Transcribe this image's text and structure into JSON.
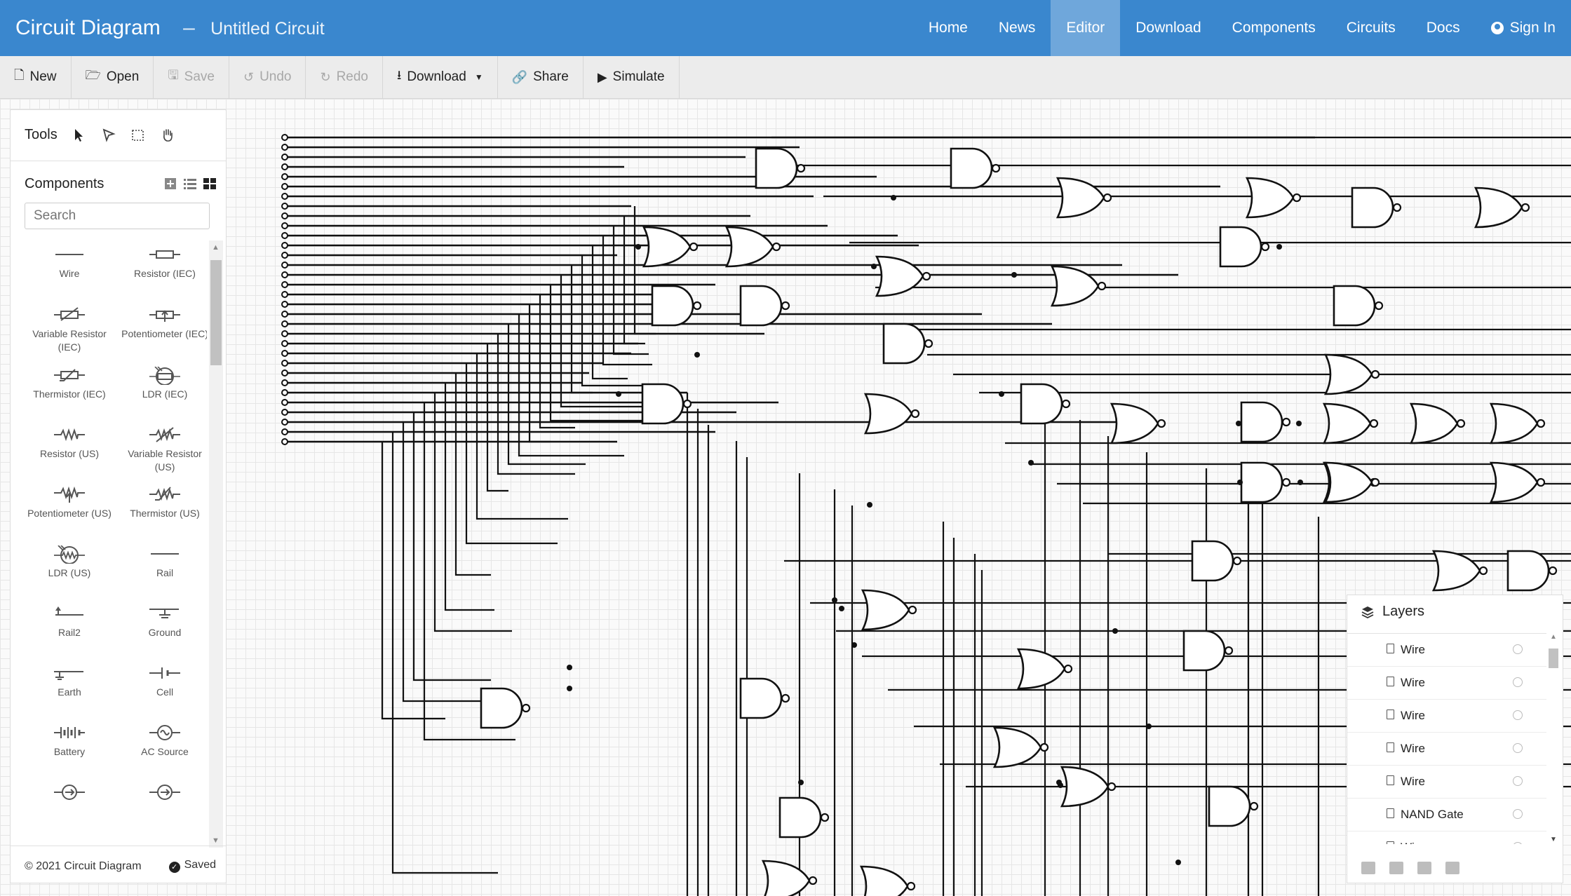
{
  "app": {
    "brand": "Circuit Diagram",
    "separator": "–",
    "document_title": "Untitled Circuit"
  },
  "nav": {
    "items": [
      {
        "label": "Home"
      },
      {
        "label": "News"
      },
      {
        "label": "Editor",
        "active": true
      },
      {
        "label": "Download"
      },
      {
        "label": "Components"
      },
      {
        "label": "Circuits"
      },
      {
        "label": "Docs"
      },
      {
        "label": "Sign In",
        "icon": "user-circle-icon"
      }
    ]
  },
  "toolbar": {
    "new": "New",
    "open": "Open",
    "save": "Save",
    "undo": "Undo",
    "redo": "Redo",
    "download": "Download",
    "share": "Share",
    "simulate": "Simulate"
  },
  "tools": {
    "title": "Tools",
    "icons": [
      "pointer-icon",
      "wire-pointer-icon",
      "select-box-icon",
      "pan-hand-icon"
    ]
  },
  "components": {
    "title": "Components",
    "search_placeholder": "Search",
    "items": [
      {
        "label": "Wire",
        "icon": "wire-icon"
      },
      {
        "label": "Resistor (IEC)",
        "icon": "resistor-iec-icon"
      },
      {
        "label": "Variable Resistor (IEC)",
        "icon": "variable-resistor-iec-icon"
      },
      {
        "label": "Potentiometer (IEC)",
        "icon": "potentiometer-iec-icon"
      },
      {
        "label": "Thermistor (IEC)",
        "icon": "thermistor-iec-icon"
      },
      {
        "label": "LDR (IEC)",
        "icon": "ldr-iec-icon"
      },
      {
        "label": "Resistor (US)",
        "icon": "resistor-us-icon"
      },
      {
        "label": "Variable Resistor (US)",
        "icon": "variable-resistor-us-icon"
      },
      {
        "label": "Potentiometer (US)",
        "icon": "potentiometer-us-icon"
      },
      {
        "label": "Thermistor (US)",
        "icon": "thermistor-us-icon"
      },
      {
        "label": "LDR (US)",
        "icon": "ldr-us-icon"
      },
      {
        "label": "Rail",
        "icon": "rail-icon"
      },
      {
        "label": "Rail2",
        "icon": "rail2-icon"
      },
      {
        "label": "Ground",
        "icon": "ground-icon"
      },
      {
        "label": "Earth",
        "icon": "earth-icon"
      },
      {
        "label": "Cell",
        "icon": "cell-icon"
      },
      {
        "label": "Battery",
        "icon": "battery-icon"
      },
      {
        "label": "AC Source",
        "icon": "ac-source-icon"
      },
      {
        "label": "",
        "icon": "current-source-icon"
      },
      {
        "label": "",
        "icon": "current-source-icon"
      }
    ]
  },
  "footer": {
    "copyright": "© 2021 Circuit Diagram",
    "status": "Saved"
  },
  "layers": {
    "title": "Layers",
    "items": [
      {
        "name": "Wire"
      },
      {
        "name": "Wire"
      },
      {
        "name": "Wire"
      },
      {
        "name": "Wire"
      },
      {
        "name": "Wire"
      },
      {
        "name": "NAND Gate"
      },
      {
        "name": "Wire"
      }
    ],
    "actions": [
      "delete-icon",
      "folder-icon",
      "folder-open-icon",
      "copy-icon"
    ]
  },
  "colors": {
    "navbar": "#3a87ce",
    "nav_active": "#6fa7db",
    "toolbar": "#ececec",
    "canvas_grid": "#e6e6e6",
    "wire": "#111111"
  }
}
